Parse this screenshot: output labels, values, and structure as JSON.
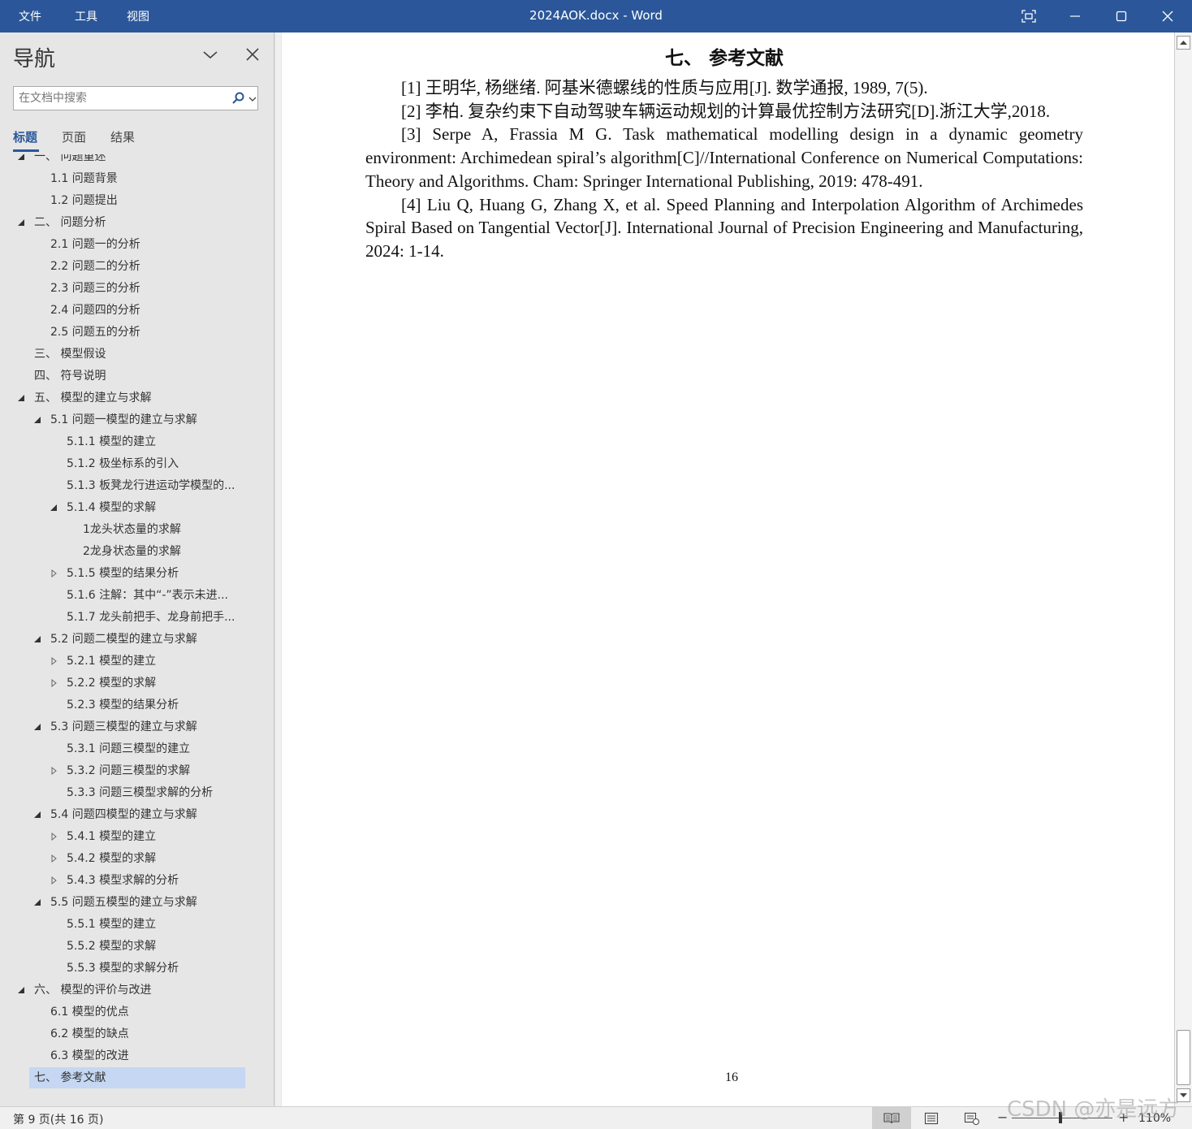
{
  "menu": {
    "file": "文件",
    "tools": "工具",
    "view": "视图"
  },
  "window": {
    "title": "2024AOK.docx  -  Word"
  },
  "nav": {
    "title": "导航",
    "search_placeholder": "在文档中搜索",
    "tabs": {
      "headings": "标题",
      "pages": "页面",
      "results": "结果"
    },
    "items": [
      {
        "label": "一、  问题重述",
        "level": 1,
        "toggle": "expanded"
      },
      {
        "label": "1.1 问题背景",
        "level": 2,
        "toggle": "none"
      },
      {
        "label": "1.2 问题提出",
        "level": 2,
        "toggle": "none"
      },
      {
        "label": "二、  问题分析",
        "level": 1,
        "toggle": "expanded"
      },
      {
        "label": "2.1 问题一的分析",
        "level": 2,
        "toggle": "none"
      },
      {
        "label": "2.2 问题二的分析",
        "level": 2,
        "toggle": "none"
      },
      {
        "label": "2.3 问题三的分析",
        "level": 2,
        "toggle": "none"
      },
      {
        "label": "2.4 问题四的分析",
        "level": 2,
        "toggle": "none"
      },
      {
        "label": "2.5 问题五的分析",
        "level": 2,
        "toggle": "none"
      },
      {
        "label": "三、  模型假设",
        "level": 1,
        "toggle": "none"
      },
      {
        "label": "四、  符号说明",
        "level": 1,
        "toggle": "none"
      },
      {
        "label": "五、  模型的建立与求解",
        "level": 1,
        "toggle": "expanded"
      },
      {
        "label": "5.1 问题一模型的建立与求解",
        "level": 2,
        "toggle": "expanded"
      },
      {
        "label": "5.1.1 模型的建立",
        "level": 3,
        "toggle": "none"
      },
      {
        "label": "5.1.2 极坐标系的引入",
        "level": 3,
        "toggle": "none"
      },
      {
        "label": "5.1.3 板凳龙行进运动学模型的...",
        "level": 3,
        "toggle": "none"
      },
      {
        "label": "5.1.4 模型的求解",
        "level": 3,
        "toggle": "expanded"
      },
      {
        "label": "1龙头状态量的求解",
        "level": 4,
        "toggle": "none"
      },
      {
        "label": "2龙身状态量的求解",
        "level": 4,
        "toggle": "none"
      },
      {
        "label": "5.1.5 模型的结果分析",
        "level": 3,
        "toggle": "collapsed"
      },
      {
        "label": "5.1.6 注解：其中“-”表示未进...",
        "level": 3,
        "toggle": "none"
      },
      {
        "label": "5.1.7 龙头前把手、龙身前把手...",
        "level": 3,
        "toggle": "none"
      },
      {
        "label": "5.2 问题二模型的建立与求解",
        "level": 2,
        "toggle": "expanded"
      },
      {
        "label": "5.2.1 模型的建立",
        "level": 3,
        "toggle": "collapsed"
      },
      {
        "label": "5.2.2 模型的求解",
        "level": 3,
        "toggle": "collapsed"
      },
      {
        "label": "5.2.3 模型的结果分析",
        "level": 3,
        "toggle": "none"
      },
      {
        "label": "5.3 问题三模型的建立与求解",
        "level": 2,
        "toggle": "expanded"
      },
      {
        "label": "5.3.1 问题三模型的建立",
        "level": 3,
        "toggle": "none"
      },
      {
        "label": "5.3.2 问题三模型的求解",
        "level": 3,
        "toggle": "collapsed"
      },
      {
        "label": "5.3.3 问题三模型求解的分析",
        "level": 3,
        "toggle": "none"
      },
      {
        "label": "5.4 问题四模型的建立与求解",
        "level": 2,
        "toggle": "expanded"
      },
      {
        "label": "5.4.1 模型的建立",
        "level": 3,
        "toggle": "collapsed"
      },
      {
        "label": "5.4.2 模型的求解",
        "level": 3,
        "toggle": "collapsed"
      },
      {
        "label": "5.4.3 模型求解的分析",
        "level": 3,
        "toggle": "collapsed"
      },
      {
        "label": "5.5 问题五模型的建立与求解",
        "level": 2,
        "toggle": "expanded"
      },
      {
        "label": "5.5.1 模型的建立",
        "level": 3,
        "toggle": "none"
      },
      {
        "label": "5.5.2 模型的求解",
        "level": 3,
        "toggle": "none"
      },
      {
        "label": "5.5.3 模型的求解分析",
        "level": 3,
        "toggle": "none"
      },
      {
        "label": "六、  模型的评价与改进",
        "level": 1,
        "toggle": "expanded"
      },
      {
        "label": "6.1 模型的优点",
        "level": 2,
        "toggle": "none"
      },
      {
        "label": "6.2 模型的缺点",
        "level": 2,
        "toggle": "none"
      },
      {
        "label": "6.3 模型的改进",
        "level": 2,
        "toggle": "none"
      },
      {
        "label": "七、  参考文献",
        "level": 1,
        "toggle": "none",
        "selected": true
      }
    ]
  },
  "document": {
    "heading": "七、 参考文献",
    "references": [
      "[1]  王明华, 杨继绪. 阿基米德螺线的性质与应用[J]. 数学通报, 1989, 7(5).",
      "[2]  李柏. 复杂约束下自动驾驶车辆运动规划的计算最优控制方法研究[D].浙江大学,2018.",
      "[3]  Serpe A, Frassia M G. Task mathematical modelling design in a dynamic geometry environment: Archimedean spiral’s algorithm[C]//International Conference on Numerical Computations: Theory and Algorithms. Cham: Springer International Publishing, 2019: 478-491.",
      "[4]  Liu Q, Huang G, Zhang X, et al. Speed Planning and Interpolation Algorithm of Archimedes Spiral Based on Tangential Vector[J]. International Journal of Precision Engineering and Manufacturing, 2024: 1-14."
    ],
    "page_number": "16"
  },
  "status": {
    "page_info": "第 9 页(共 16 页)",
    "zoom": "110%",
    "zoom_minus": "−",
    "zoom_plus": "+",
    "zoom_level_fraction": 0.48
  },
  "watermark": "CSDN @亦是远方",
  "colors": {
    "accent": "#2b579a",
    "selection": "#c5d7f2"
  }
}
